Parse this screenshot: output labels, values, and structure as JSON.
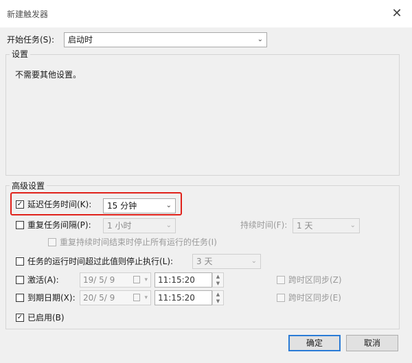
{
  "window": {
    "title": "新建触发器",
    "close_glyph": "✕"
  },
  "begin_task": {
    "label": "开始任务(S):",
    "value": "启动时"
  },
  "settings_group": {
    "title": "设置",
    "message": "不需要其他设置。"
  },
  "advanced_group": {
    "title": "高级设置",
    "delay": {
      "label": "延迟任务时间(K):",
      "value": "15 分钟",
      "checked": true
    },
    "repeat": {
      "label": "重复任务间隔(P):",
      "value": "1 小时",
      "duration_label": "持续时间(F):",
      "duration_value": "1 天",
      "checked": false
    },
    "stop_all": {
      "label": "重复持续时间结束时停止所有运行的任务(I)",
      "checked": false
    },
    "stop_if_longer": {
      "label": "任务的运行时间超过此值则停止执行(L):",
      "value": "3 天",
      "checked": false
    },
    "activate": {
      "label": "激活(A):",
      "date": "19/ 5/ 9",
      "time": "11:15:20",
      "sync_label": "跨时区同步(Z)",
      "checked": false
    },
    "expire": {
      "label": "到期日期(X):",
      "date": "20/ 5/ 9",
      "time": "11:15:20",
      "sync_label": "跨时区同步(E)",
      "checked": false
    },
    "enabled": {
      "label": "已启用(B)",
      "checked": true
    }
  },
  "buttons": {
    "ok": "确定",
    "cancel": "取消"
  },
  "colors": {
    "highlight": "#e0211a",
    "primary_border": "#2a7bd6"
  }
}
